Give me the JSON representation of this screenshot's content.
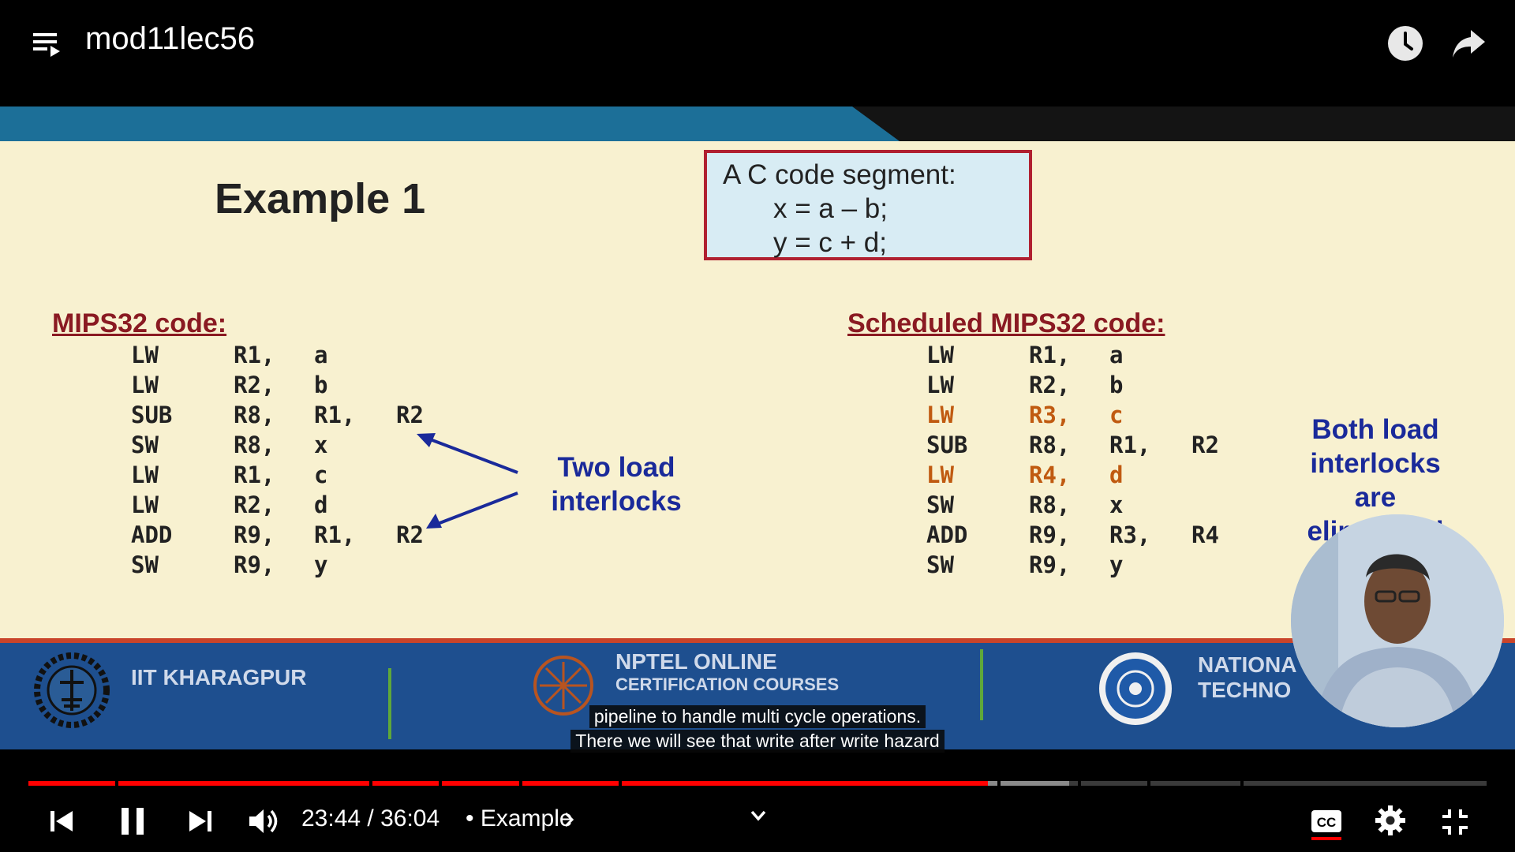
{
  "header": {
    "video_title": "mod11lec56",
    "playlist_icon": "playlist-icon",
    "watch_later_icon": "clock-icon",
    "share_icon": "share-arrow-icon"
  },
  "slide": {
    "title": "Example 1",
    "c_code": {
      "heading": "A C code segment:",
      "lines": [
        "x = a – b;",
        "y = c + d;"
      ]
    },
    "mips_heading": "MIPS32 code:",
    "mips_code": [
      {
        "op": "LW",
        "a": "R1,",
        "b": "a",
        "c": ""
      },
      {
        "op": "LW",
        "a": "R2,",
        "b": "b",
        "c": ""
      },
      {
        "op": "SUB",
        "a": "R8,",
        "b": "R1,",
        "c": "R2"
      },
      {
        "op": "SW",
        "a": "R8,",
        "b": "x",
        "c": ""
      },
      {
        "op": "LW",
        "a": "R1,",
        "b": "c",
        "c": ""
      },
      {
        "op": "LW",
        "a": "R2,",
        "b": "d",
        "c": ""
      },
      {
        "op": "ADD",
        "a": "R9,",
        "b": "R1,",
        "c": "R2"
      },
      {
        "op": "SW",
        "a": "R9,",
        "b": "y",
        "c": ""
      }
    ],
    "interlock_note": [
      "Two load",
      "interlocks"
    ],
    "scheduled_heading": "Scheduled MIPS32 code:",
    "scheduled_code": [
      {
        "op": "LW",
        "a": "R1,",
        "b": "a",
        "c": "",
        "highlight": false
      },
      {
        "op": "LW",
        "a": "R2,",
        "b": "b",
        "c": "",
        "highlight": false
      },
      {
        "op": "LW",
        "a": "R3,",
        "b": "c",
        "c": "",
        "highlight": true
      },
      {
        "op": "SUB",
        "a": "R8,",
        "b": "R1,",
        "c": "R2",
        "highlight": false
      },
      {
        "op": "LW",
        "a": "R4,",
        "b": "d",
        "c": "",
        "highlight": true
      },
      {
        "op": "SW",
        "a": "R8,",
        "b": "x",
        "c": "",
        "highlight": false
      },
      {
        "op": "ADD",
        "a": "R9,",
        "b": "R3,",
        "c": "R4",
        "highlight": false
      },
      {
        "op": "SW",
        "a": "R9,",
        "b": "y",
        "c": "",
        "highlight": false
      }
    ],
    "eliminated_note": [
      "Both load",
      "interlocks",
      "are",
      "eliminated"
    ],
    "footer": {
      "left_text": "IIT KHARAGPUR",
      "center_text_1": "NPTEL ONLINE",
      "center_text_2": "CERTIFICATION COURSES",
      "right_text_1": "NATIONA",
      "right_text_2": "TECHNO"
    }
  },
  "captions": [
    "pipeline to handle multi cycle operations.",
    "There we will see that write after write hazard"
  ],
  "player": {
    "current_time": "23:44",
    "duration": "36:04",
    "time_separator": " / ",
    "chapter": "• Example",
    "progress_fraction": 0.658,
    "buffered_fraction": 0.714,
    "cc_icon": "closed-captions-icon",
    "settings_icon": "gear-icon",
    "exit_fullscreen_icon": "exit-fullscreen-icon",
    "accent_color": "#ff0000"
  }
}
